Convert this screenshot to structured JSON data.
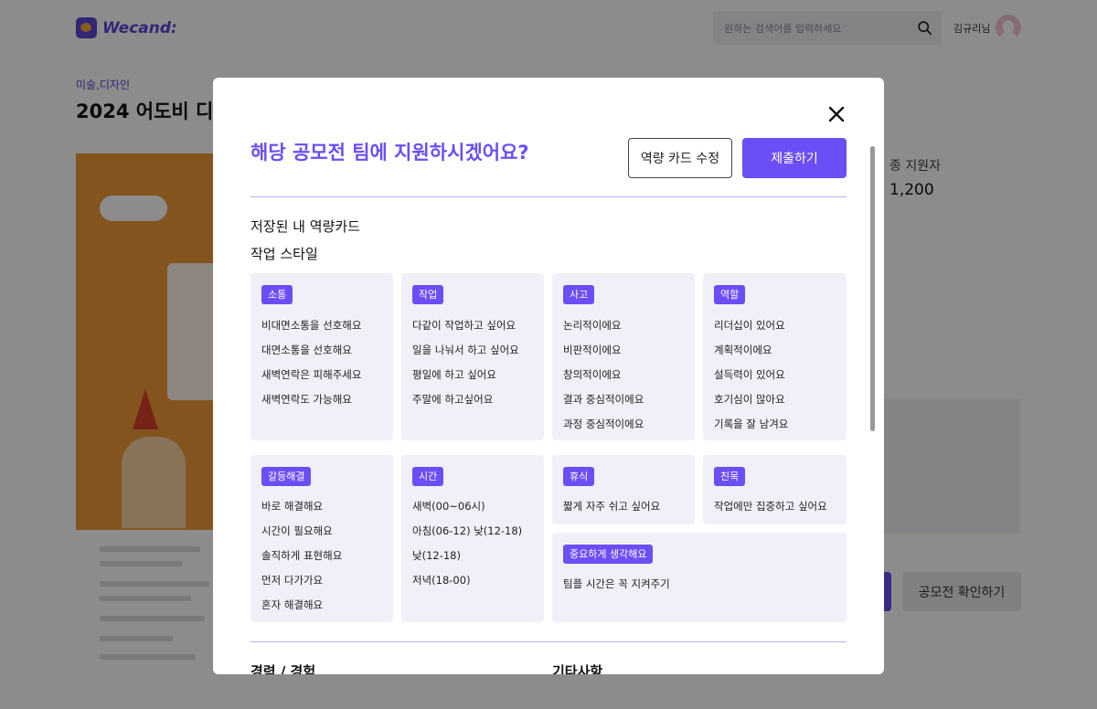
{
  "header": {
    "logo_text": "Wecand:",
    "search_placeholder": "원하는 검색어를 입력하세요",
    "username": "김규리님"
  },
  "page": {
    "category": "미술,디자인",
    "title": "2024 어도비 디",
    "applicants_label": "종 지원자",
    "applicants_value": "1,200",
    "confirm_button": "공모전 확인하기"
  },
  "modal": {
    "title": "해당 공모전 팀에 지원하시겠어요?",
    "edit_button": "역량 카드 수정",
    "submit_button": "제출하기",
    "saved_cards_title": "저장된 내 역량카드",
    "work_style_title": "작업 스타일",
    "cards": [
      {
        "tag": "소통",
        "items": [
          "비대면소통을 선호해요",
          "대면소통을 선호해요",
          "새벽연락은 피해주세요",
          "새벽연락도 가능해요"
        ]
      },
      {
        "tag": "작업",
        "items": [
          "다같이 작업하고 싶어요",
          "일을 나눠서 하고 싶어요",
          "평일에 하고 싶어요",
          "주말에 하고싶어요"
        ]
      },
      {
        "tag": "사고",
        "items": [
          "논리적이에요",
          "비판적이에요",
          "창의적이에요",
          "결과 중심적이에요",
          "과정 중심적이에요"
        ]
      },
      {
        "tag": "역할",
        "items": [
          "리더십이 있어요",
          "계획적이에요",
          "설득력이 있어요",
          "호기심이 많아요",
          "기록을 잘 남겨요"
        ]
      },
      {
        "tag": "갈등해결",
        "items": [
          "바로 해결해요",
          "시간이 필요해요",
          "솔직하게 표현해요",
          "먼저 다가가요",
          "혼자 해결해요"
        ]
      },
      {
        "tag": "시간",
        "items": [
          "새벽(00~06시)",
          "아침(06-12) 낮(12-18)",
          "낮(12-18)",
          "저녁(18-00)"
        ]
      },
      {
        "tag": "휴식",
        "items": [
          "짧게 자주 쉬고 싶어요"
        ]
      },
      {
        "tag": "친목",
        "items": [
          "작업에만 집중하고 싶어요"
        ]
      },
      {
        "tag": "중요하게 생각해요",
        "items": [
          "팀플 시간은 꼭 지켜주기"
        ]
      }
    ],
    "experience_title": "경력 / 경험",
    "etc_title": "기타사항"
  }
}
